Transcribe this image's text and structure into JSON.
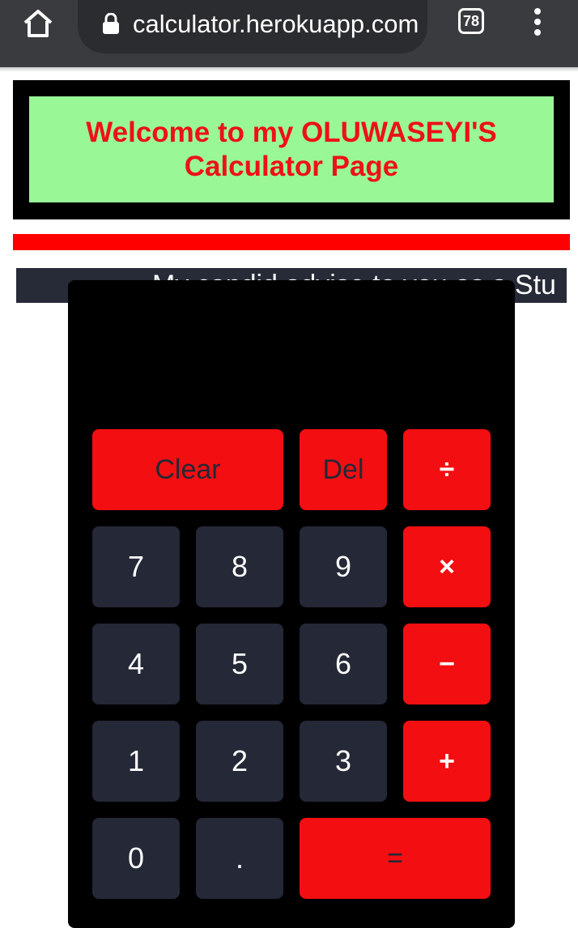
{
  "browser": {
    "url": "calculator.herokuapp.com",
    "tab_count": "78"
  },
  "header": {
    "title": "Welcome to my OLUWASEYI'S Calculator Page"
  },
  "marquee": {
    "text": "My candid advise to you as a Stu"
  },
  "calculator": {
    "display": "",
    "keys": {
      "clear": "Clear",
      "del": "Del",
      "divide": "÷",
      "seven": "7",
      "eight": "8",
      "nine": "9",
      "multiply": "×",
      "four": "4",
      "five": "5",
      "six": "6",
      "subtract": "−",
      "one": "1",
      "two": "2",
      "three": "3",
      "add": "+",
      "zero": "0",
      "dot": ".",
      "equals": "="
    }
  },
  "colors": {
    "header_bg": "#99f796",
    "title_red": "#ee1115",
    "operator_red": "#f30e11",
    "digit_key": "#252836",
    "calc_body": "#000000"
  }
}
